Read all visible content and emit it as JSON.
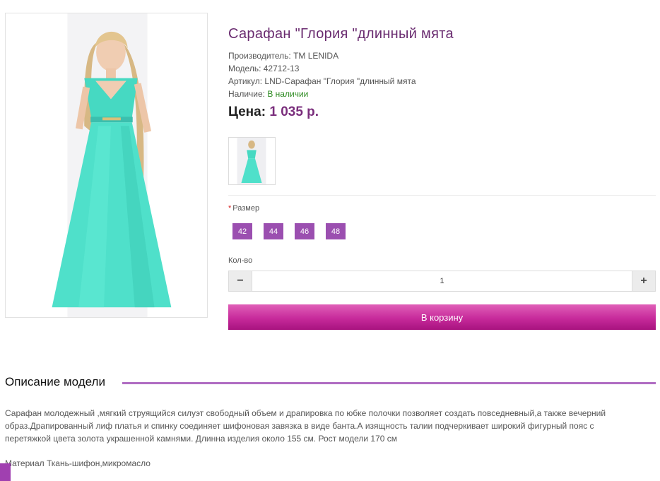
{
  "product": {
    "title": "Сарафан \"Глория \"длинный мята",
    "manufacturer": "Производитель: ТМ LENIDA",
    "model": "Модель: 42712-13",
    "article": "Артикул: LND-Сарафан \"Глория \"длинный мята",
    "availability_label": "Наличие: ",
    "availability_value": "В наличии",
    "price_label": "Цена:",
    "price_value": "1 035 р."
  },
  "options": {
    "required_mark": "*",
    "size_label": "Размер",
    "sizes": [
      "42",
      "44",
      "46",
      "48"
    ],
    "quantity_label": "Кол-во",
    "quantity_value": "1",
    "minus": "−",
    "plus": "+"
  },
  "cart": {
    "button_label": "В корзину"
  },
  "description": {
    "heading": "Описание модели",
    "text": "Сарафан молодежный ,мягкий струящийся силуэт свободный объем и драпировка по юбке полочки позволяет создать повседневный,а также вечерний образ.Драпированный лиф платья и спинку соединяет шифоновая завязка в виде банта.А изящность талии подчеркивает широкий фигурный пояс с перетяжкой цвета золота украшенной камнями. Длинна изделия около 155 см. Рост модели 170 см",
    "material": "Материал Ткань-шифон,микромасло"
  },
  "colors": {
    "title": "#6a2c70",
    "price": "#7a2e7c",
    "size_button": "#9b4fb0",
    "cart_button": "#c72a9b",
    "heading_rule": "#b06cc2",
    "in_stock": "#2e8b22"
  }
}
